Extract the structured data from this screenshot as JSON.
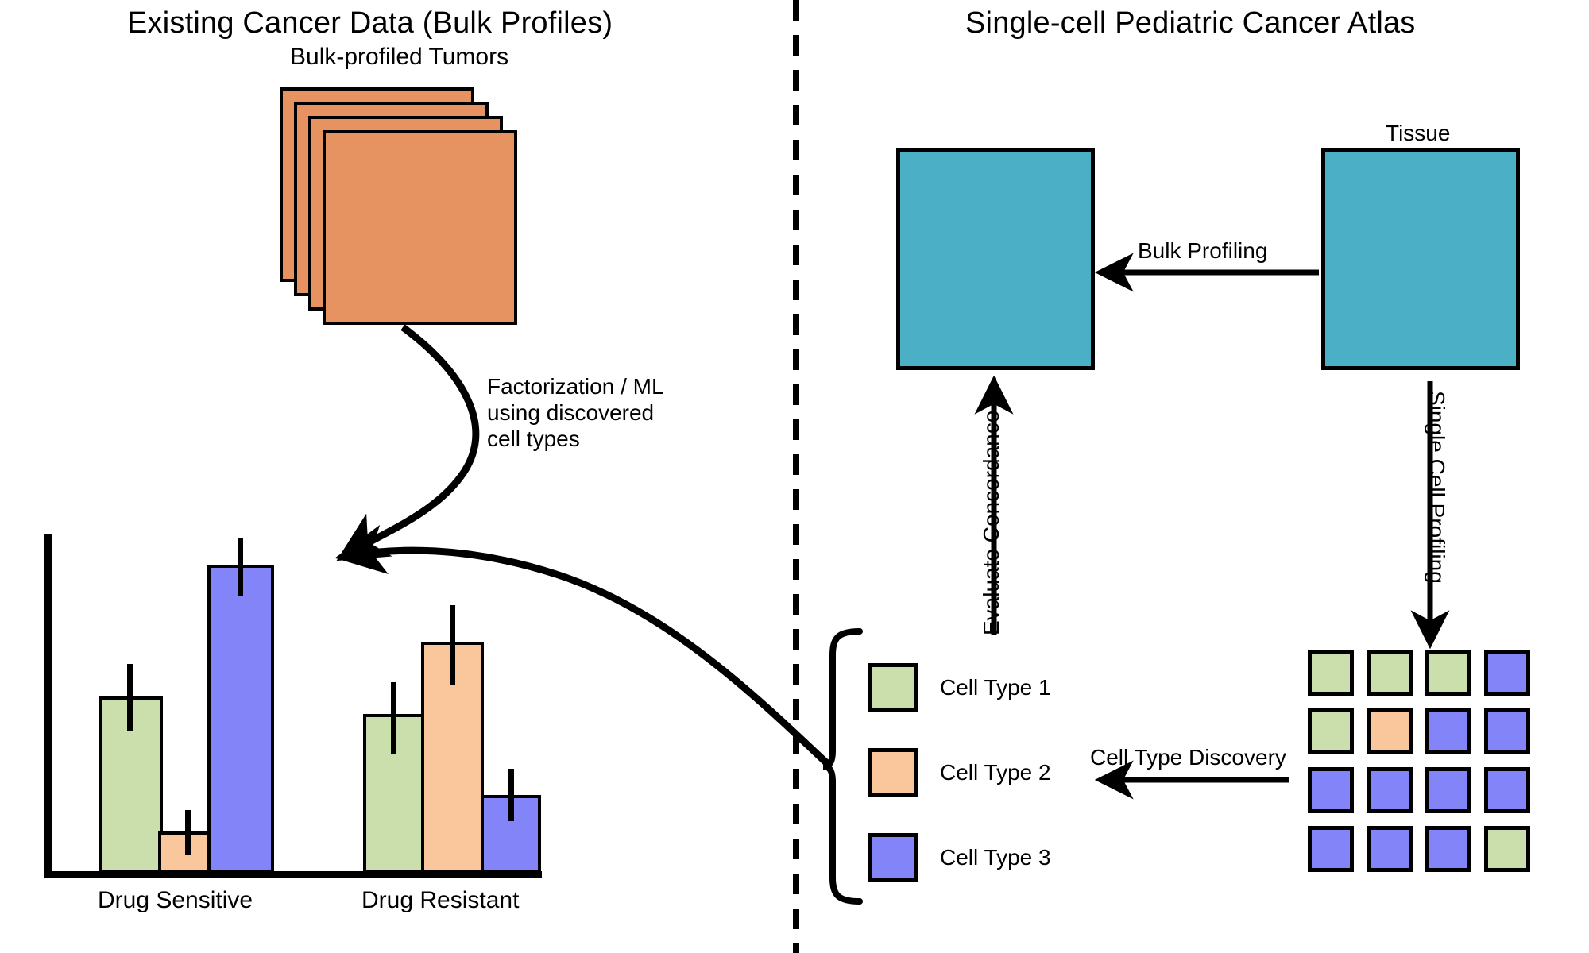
{
  "panels": {
    "left_title": "Existing Cancer Data (Bulk Profiles)",
    "right_title": "Single-cell Pediatric Cancer Atlas"
  },
  "left": {
    "stack_label": "Bulk-profiled Tumors",
    "annotation_lines": [
      "Factorization / ML",
      "using discovered",
      "cell types"
    ],
    "stack_color": "#E79361",
    "stack_card_count": 4
  },
  "right": {
    "tissue_label": "Tissue",
    "bulk_profiling_label": "Bulk Profiling",
    "single_cell_profiling_label": "Single Cell Profiling",
    "evaluate_concordance_label": "Evaluate Concordance",
    "cell_type_discovery_label": "Cell Type Discovery",
    "tissue_color": "#4BAFC6",
    "bulk_box_color": "#4BAFC6"
  },
  "legend": {
    "items": [
      {
        "label": "Cell Type 1",
        "color": "#CADFAC"
      },
      {
        "label": "Cell Type 2",
        "color": "#FAC69B"
      },
      {
        "label": "Cell Type 3",
        "color": "#8284F7"
      }
    ]
  },
  "cell_grid": {
    "rows": 4,
    "cols": 4,
    "colors": [
      [
        "#CADFAC",
        "#CADFAC",
        "#CADFAC",
        "#8284F7"
      ],
      [
        "#CADFAC",
        "#FAC69B",
        "#8284F7",
        "#8284F7"
      ],
      [
        "#8284F7",
        "#8284F7",
        "#8284F7",
        "#8284F7"
      ],
      [
        "#8284F7",
        "#8284F7",
        "#8284F7",
        "#CADFAC"
      ]
    ]
  },
  "chart_data": {
    "type": "bar",
    "title": "",
    "xlabel": "",
    "ylabel": "",
    "grid": false,
    "legend_position": "external-right",
    "categories": [
      "Drug Sensitive",
      "Drug Resistant"
    ],
    "series": [
      {
        "name": "Cell Type 1",
        "color": "#CADFAC",
        "values": [
          0.47,
          0.42
        ],
        "errors": [
          0.09,
          0.1
        ]
      },
      {
        "name": "Cell Type 2",
        "color": "#FAC69B",
        "values": [
          0.11,
          0.56
        ],
        "errors": [
          0.06,
          0.09
        ]
      },
      {
        "name": "Cell Type 3",
        "color": "#8284F7",
        "values": [
          0.82,
          0.26
        ],
        "errors": [
          0.08,
          0.07
        ]
      }
    ],
    "ylim": [
      0,
      1.0
    ],
    "tick_labels": []
  }
}
